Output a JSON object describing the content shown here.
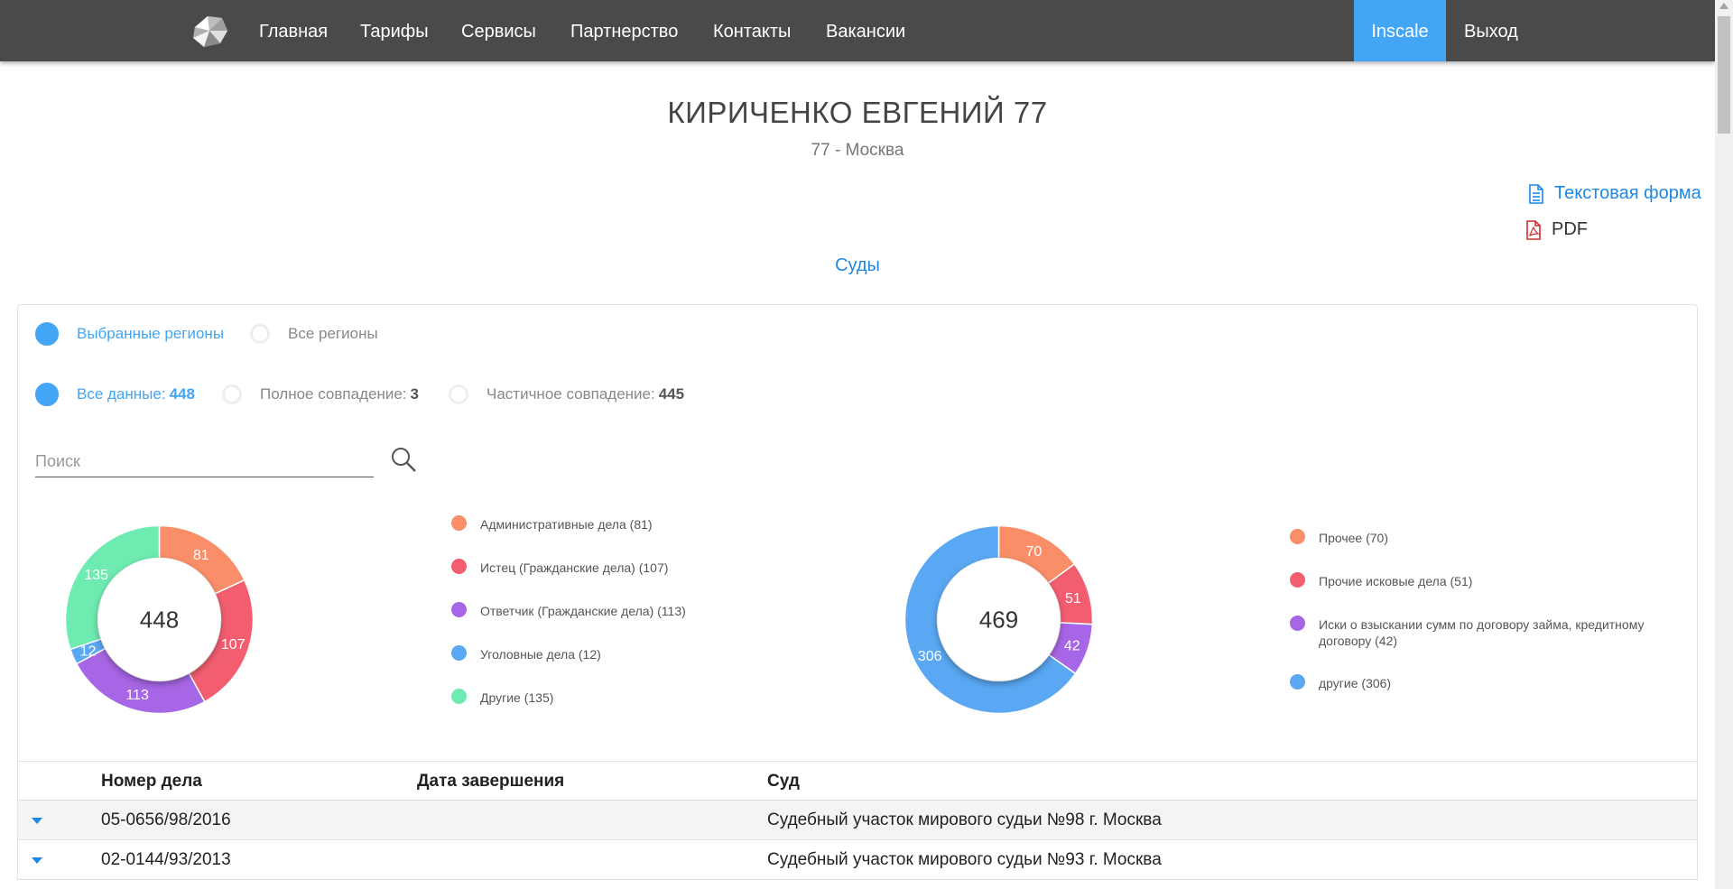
{
  "nav": {
    "items": [
      "Главная",
      "Тарифы",
      "Сервисы",
      "Партнерство",
      "Контакты",
      "Вакансии"
    ],
    "inscale": "Inscale",
    "logout": "Выход"
  },
  "header": {
    "title": "КИРИЧЕНКО ЕВГЕНИЙ 77",
    "subtitle": "77 - Москва"
  },
  "links": {
    "text_form": "Текстовая форма",
    "pdf": "PDF"
  },
  "tab": "Суды",
  "filters": {
    "region_selected": "Выбранные регионы",
    "region_all": "Все регионы",
    "all_data_label": "Все данные:",
    "all_data_count": "448",
    "full_match_label": "Полное совпадение:",
    "full_match_count": "3",
    "partial_match_label": "Частичное совпадение:",
    "partial_match_count": "445"
  },
  "search": {
    "placeholder": "Поиск"
  },
  "chart_data": [
    {
      "type": "pie",
      "center_label": "448",
      "categories": [
        "Административные дела",
        "Истец (Гражданские дела)",
        "Ответчик (Гражданские дела)",
        "Уголовные дела",
        "Другие"
      ],
      "values": [
        81,
        107,
        113,
        12,
        135
      ],
      "legend": [
        "Административные дела (81)",
        "Истец (Гражданские дела) (107)",
        "Ответчик (Гражданские дела) (113)",
        "Уголовные дела (12)",
        "Другие (135)"
      ],
      "colors": [
        "#f98e68",
        "#f25e70",
        "#a766e5",
        "#5aa8f3",
        "#6eebb1"
      ]
    },
    {
      "type": "pie",
      "center_label": "469",
      "categories": [
        "Прочее",
        "Прочие исковые дела",
        "Иски о взыскании сумм по договору займа, кредитному договору",
        "другие"
      ],
      "values": [
        70,
        51,
        42,
        306
      ],
      "legend": [
        "Прочее (70)",
        "Прочие исковые дела (51)",
        "Иски о взыскании сумм по договору займа, кредитному договору (42)",
        "другие (306)"
      ],
      "colors": [
        "#f98e68",
        "#f25e70",
        "#a766e5",
        "#5aa8f3"
      ]
    }
  ],
  "table": {
    "headers": [
      "Номер дела",
      "Дата завершения",
      "Суд"
    ],
    "rows": [
      {
        "number": "05-0656/98/2016",
        "date": "",
        "court": "Судебный участок мирового судьи №98 г. Москва"
      },
      {
        "number": "02-0144/93/2013",
        "date": "",
        "court": "Судебный участок мирового судьи №93 г. Москва"
      }
    ]
  }
}
